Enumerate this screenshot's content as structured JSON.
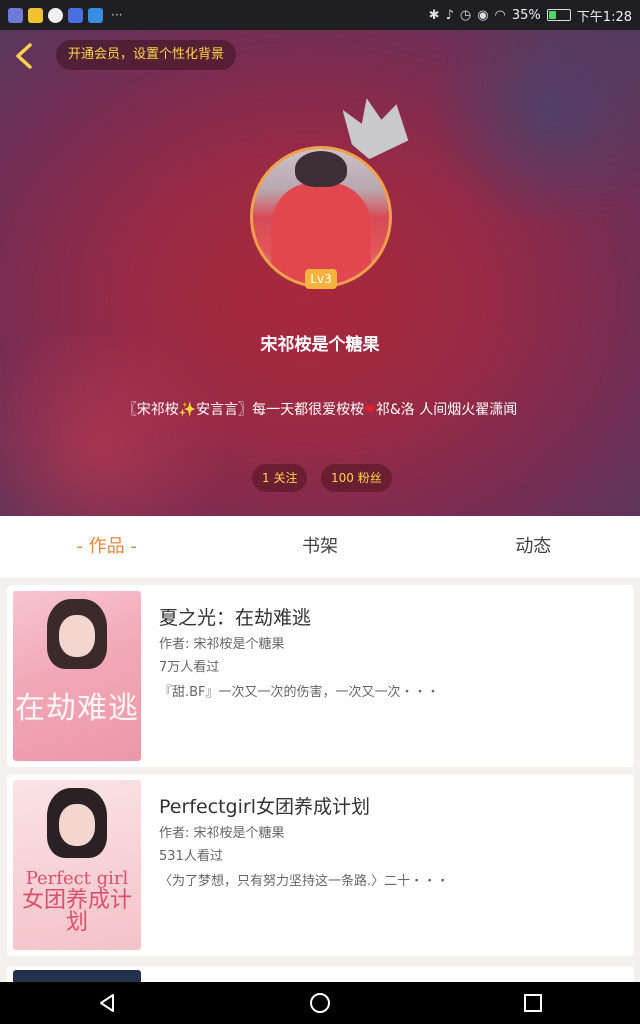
{
  "status_bar": {
    "battery": "35%",
    "battery_level": 0.35,
    "time": "下午1:28"
  },
  "header": {
    "vip_text": "开通会员，设置个性化背景",
    "level": "Lv3",
    "username": "宋祁桉是个糖果",
    "bio": {
      "part1": "〖宋祁桉",
      "sparkle": "✨",
      "part2": "安言言〗每一天都很爱桉桉",
      "heart": "❤",
      "part3": "祁&洛 人间烟火翟潇闻"
    },
    "following": "1 关注",
    "followers": "100 粉丝"
  },
  "tabs": [
    {
      "label": "- 作品 -",
      "active": true
    },
    {
      "label": "书架",
      "active": false
    },
    {
      "label": "动态",
      "active": false
    }
  ],
  "books": [
    {
      "title": "夏之光：在劫难逃",
      "author": "作者: 宋祁桉是个糖果",
      "views": "7万人看过",
      "desc": "『甜.BF』一次又一次的伤害，一次又一次・・・",
      "cover_text": "在劫难逃"
    },
    {
      "title": "Perfectgirl女团养成计划",
      "author": "作者: 宋祁桉是个糖果",
      "views": "531人看过",
      "desc": "〈为了梦想，只有努力坚持这一条路.〉二十・・・",
      "cover_text_en": "Perfect girl",
      "cover_text_zh": "女团养成计划"
    }
  ],
  "colors": {
    "accent": "#e8863c",
    "vip_text": "#ffd44a",
    "level_badge": "#f3b33d"
  }
}
